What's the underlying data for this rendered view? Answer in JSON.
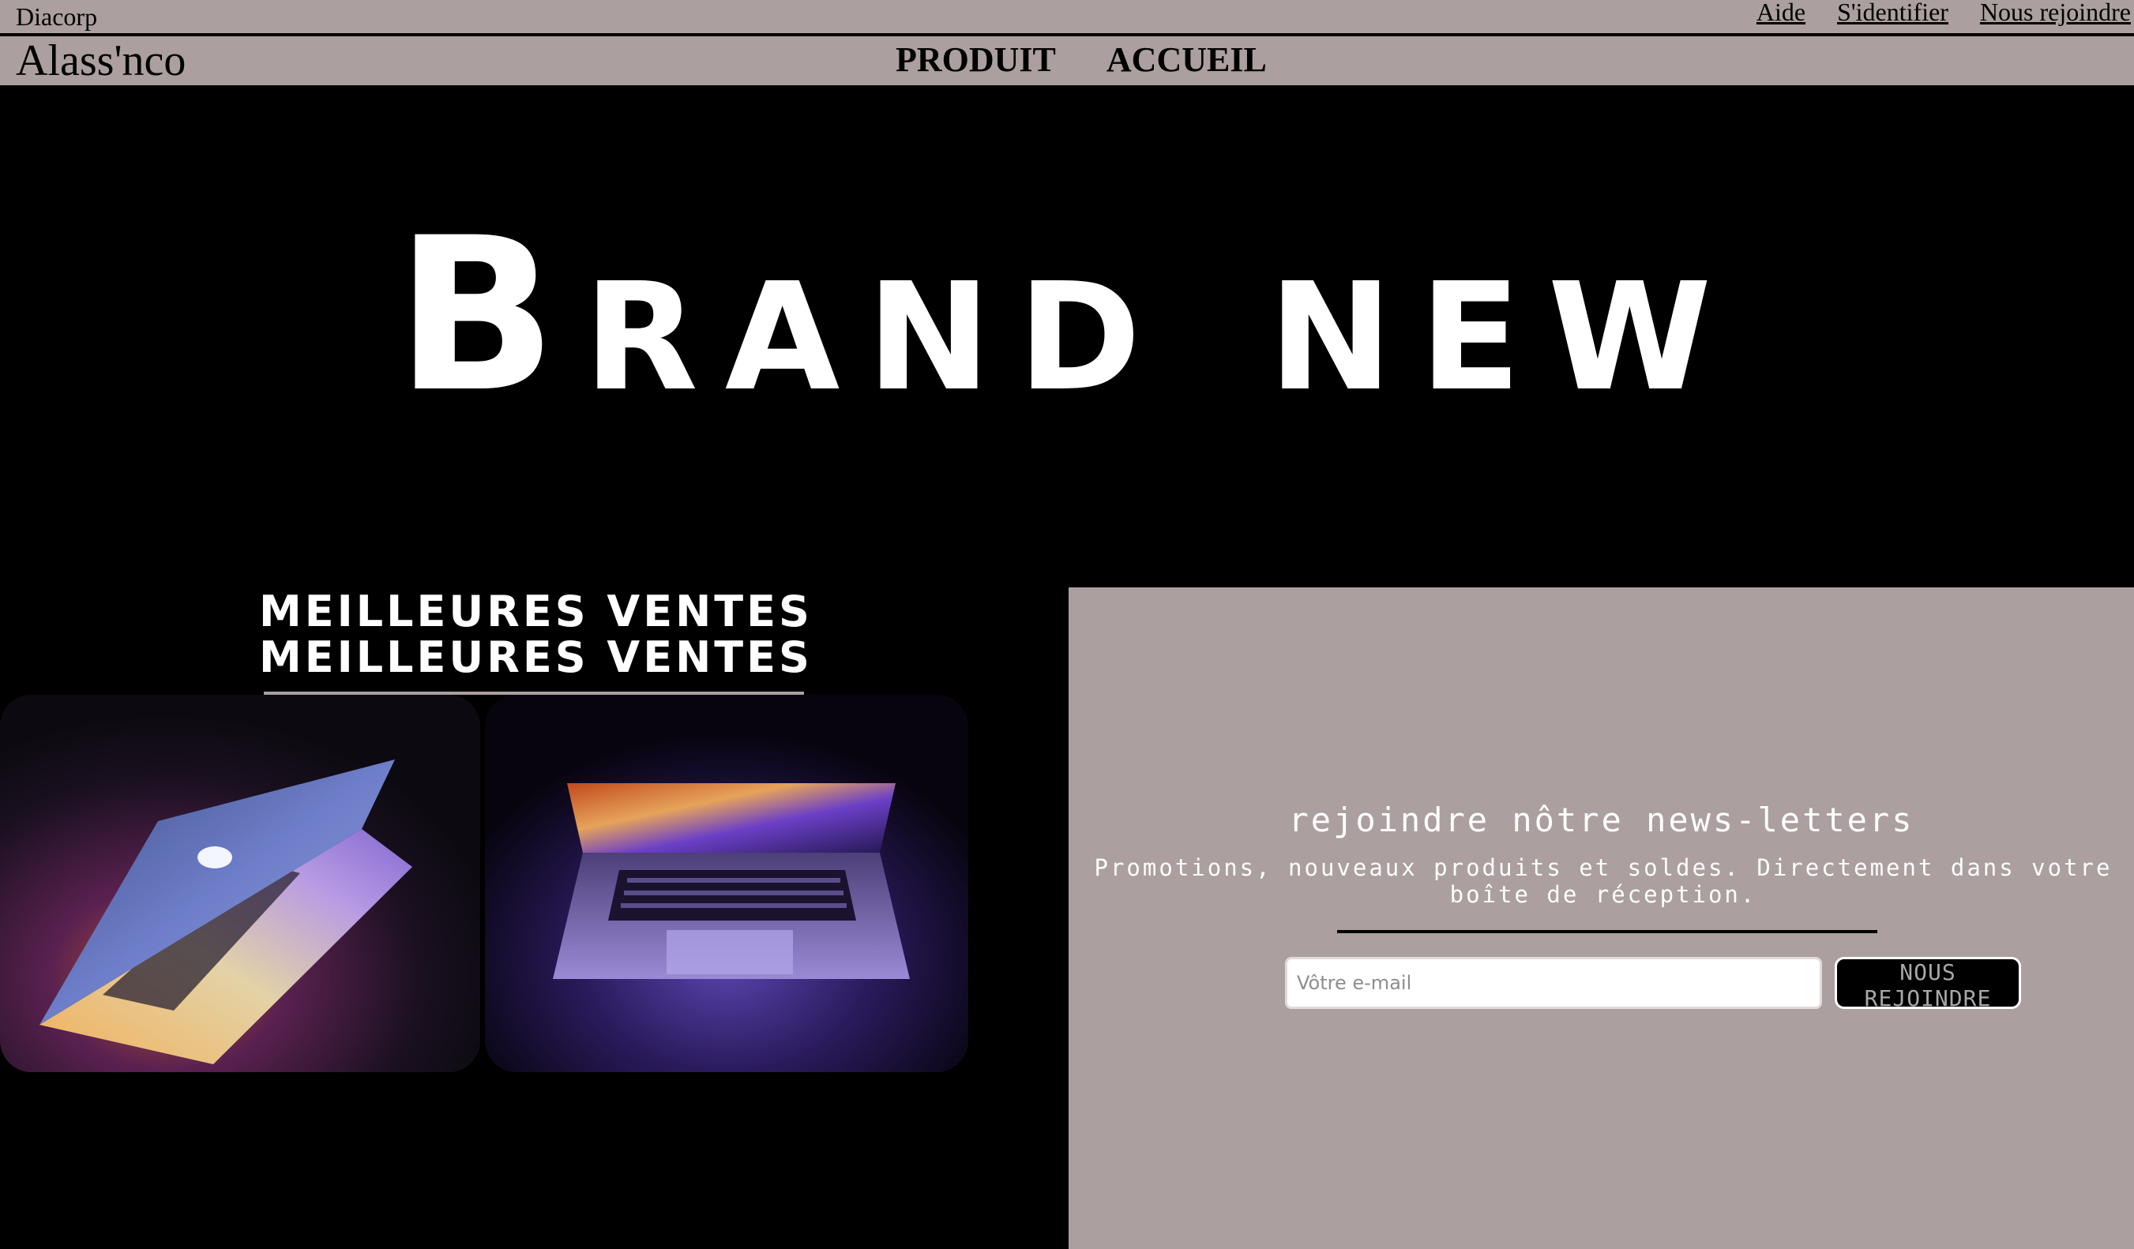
{
  "topbar": {
    "company": "Diacorp",
    "links": [
      "Aide",
      "S'identifier",
      "Nous rejoindre"
    ]
  },
  "navbar": {
    "logo": "Alass'nco",
    "links": [
      "PRODUIT",
      "ACCUEIL"
    ]
  },
  "hero": {
    "title": "Brand new"
  },
  "best_sellers": {
    "title_lines": [
      "MEILLEURES VENTES",
      "MEILLEURES VENTES"
    ],
    "products": [
      {
        "image": "laptop-open-side-view"
      },
      {
        "image": "laptop-open-front-view"
      }
    ]
  },
  "newsletter": {
    "title": "rejoindre nôtre news-letters",
    "text": "Promotions, nouveaux produits et soldes. Directement dans votre boîte de réception.",
    "email_placeholder": "Vôtre e-mail",
    "email_value": "",
    "button_label": "NOUS REJOINDRE"
  },
  "colors": {
    "bar_background": "#ab9f9f",
    "page_background": "#000000",
    "text_light": "#ffffff"
  }
}
